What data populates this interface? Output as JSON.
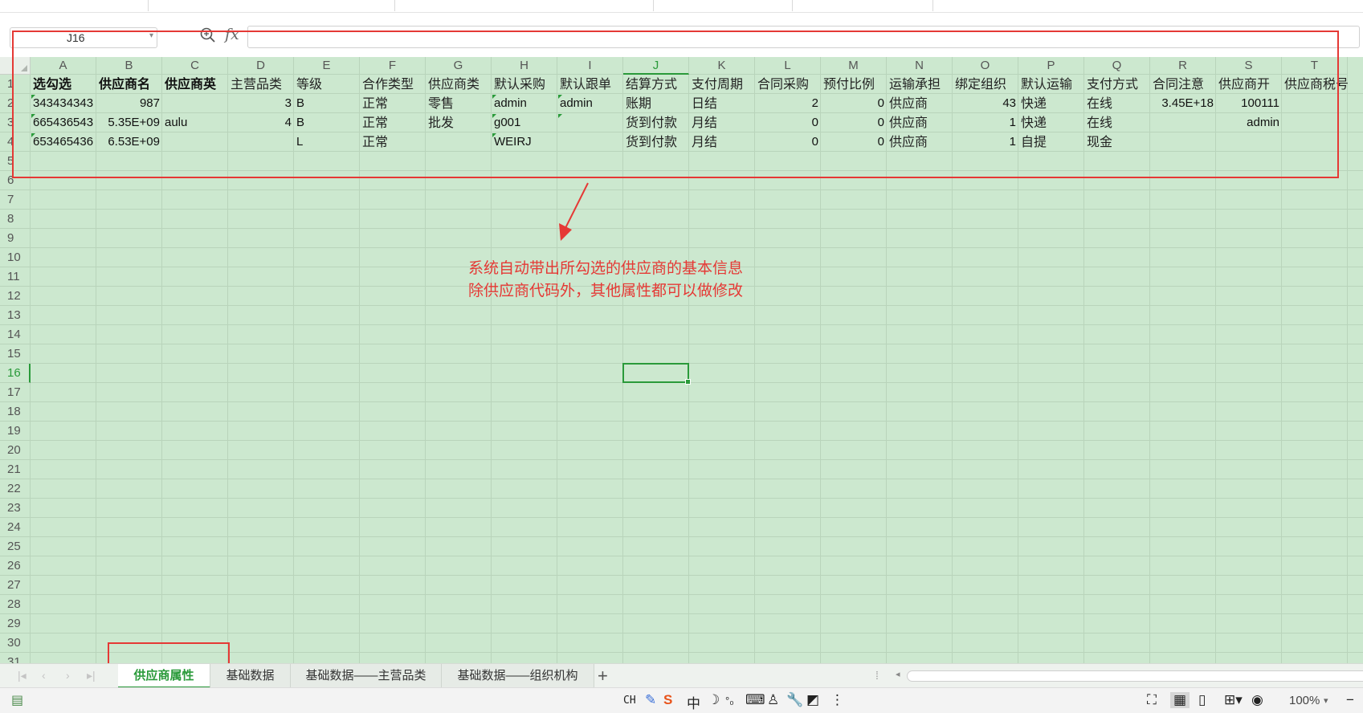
{
  "formula_bar": {
    "name_box": "J16",
    "fx_label": "fx",
    "formula": ""
  },
  "columns": [
    "A",
    "B",
    "C",
    "D",
    "E",
    "F",
    "G",
    "H",
    "I",
    "J",
    "K",
    "L",
    "M",
    "N",
    "O",
    "P",
    "Q",
    "R",
    "S",
    "T"
  ],
  "active_column": "J",
  "row_numbers": [
    "1",
    "2",
    "3",
    "4",
    "5",
    "6",
    "7",
    "8",
    "9",
    "10",
    "11",
    "12",
    "13",
    "14",
    "15",
    "16",
    "17",
    "18",
    "19",
    "20",
    "21",
    "22",
    "23",
    "24",
    "25",
    "26",
    "27",
    "28",
    "29",
    "30",
    "31"
  ],
  "active_row": "16",
  "rows": [
    [
      "选勾选",
      "供应商名",
      "供应商英",
      "主营品类",
      "等级",
      "合作类型",
      "供应商类",
      "默认采购",
      "默认跟单",
      "结算方式",
      "支付周期",
      "合同采购",
      "预付比例",
      "运输承担",
      "绑定组织",
      "默认运输",
      "支付方式",
      "合同注意",
      "供应商开",
      "供应商税号"
    ],
    [
      "343434343",
      "987",
      "",
      "3",
      "B",
      "正常",
      "零售",
      "admin",
      "admin",
      "账期",
      "日结",
      "2",
      "0",
      "供应商",
      "43",
      "快递",
      "在线",
      "3.45E+18",
      "100111",
      ""
    ],
    [
      "665436543",
      "5.35E+09",
      "aulu",
      "4",
      "B",
      "正常",
      "批发",
      "g001",
      "",
      "货到付款",
      "月结",
      "0",
      "0",
      "供应商",
      "1",
      "快递",
      "在线",
      "",
      "admin",
      ""
    ],
    [
      "653465436",
      "6.53E+09",
      "",
      "",
      "L",
      "正常",
      "",
      "WEIRJ",
      "",
      "货到付款",
      "月结",
      "0",
      "0",
      "供应商",
      "1",
      "自提",
      "现金",
      "",
      "",
      ""
    ]
  ],
  "annotation": {
    "line1": "系统自动带出所勾选的供应商的基本信息",
    "line2": "除供应商代码外，其他属性都可以做修改"
  },
  "sheet_tabs": [
    {
      "label": "供应商属性",
      "active": true
    },
    {
      "label": "基础数据",
      "active": false
    },
    {
      "label": "基础数据——主营品类",
      "active": false
    },
    {
      "label": "基础数据——组织机构",
      "active": false
    }
  ],
  "tab_add_label": "+",
  "status": {
    "ime_label": "CH",
    "ime_chinese": "中",
    "zoom": "100%"
  },
  "colors": {
    "grid_bg": "#cce8cf",
    "accent": "#2a9a3a",
    "annotation_red": "#e53935"
  }
}
